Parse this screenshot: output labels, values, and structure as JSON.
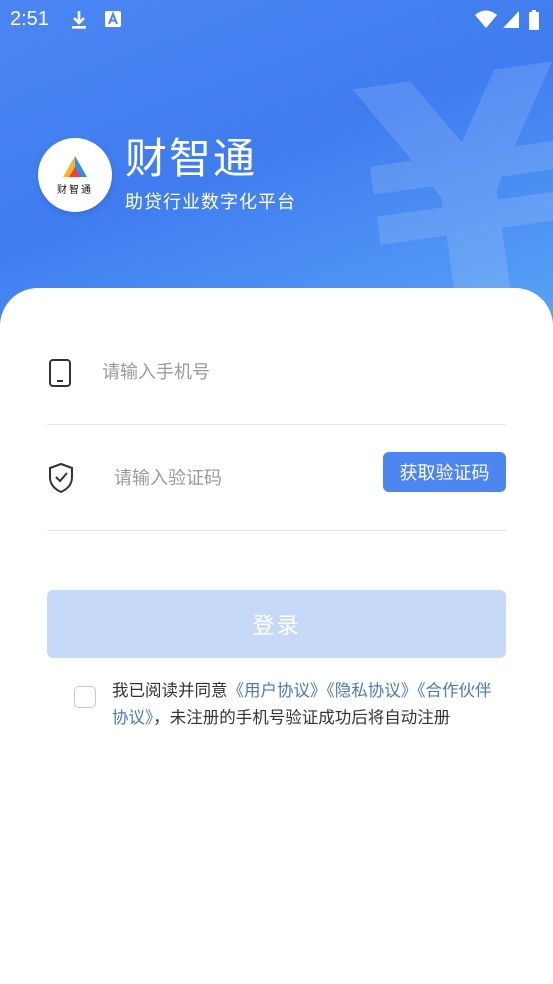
{
  "status_bar": {
    "time": "2:51",
    "icons": [
      "download-icon",
      "a-notification-icon",
      "wifi-icon",
      "signal-icon",
      "battery-icon"
    ]
  },
  "header": {
    "logo_text": "财智通",
    "app_name": "财智通",
    "tagline": "助贷行业数字化平台",
    "watermark_icon": "yen-icon"
  },
  "form": {
    "phone": {
      "icon": "phone-icon",
      "placeholder": "请输入手机号",
      "value": ""
    },
    "code": {
      "icon": "shield-check-icon",
      "placeholder": "请输入验证码",
      "value": ""
    },
    "get_code_label": "获取验证码",
    "login_label": "登录"
  },
  "agreement": {
    "checked": false,
    "prefix": "我已阅读并同意",
    "link_user": "《用户协议》",
    "link_privacy": "《隐私协议》",
    "link_partner": "《合作伙伴协议》",
    "suffix": "，未注册的手机号验证成功后将自动注册"
  },
  "colors": {
    "primary": "#4d86f0",
    "header_gradient_start": "#4a86f2",
    "header_gradient_end": "#5aa4f6",
    "login_disabled": "#c7d9f8",
    "link": "#4a77c5"
  }
}
